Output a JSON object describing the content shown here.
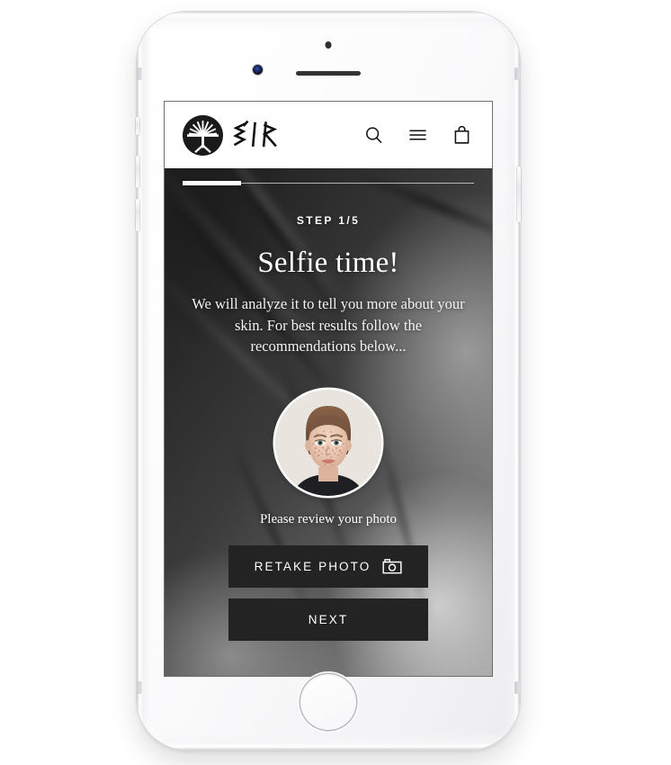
{
  "device": {
    "name": "iphone-white",
    "hardware": {
      "front_camera": "front-camera",
      "earpiece": "earpiece-speaker",
      "sensor": "proximity-sensor",
      "home_button": "home-button",
      "silent_switch": "silent-switch",
      "volume_up": "volume-up-button",
      "volume_down": "volume-down-button",
      "power": "power-button"
    }
  },
  "header": {
    "logo_name": "eir-tree-logo",
    "wordmark": "EIR",
    "icons": [
      {
        "name": "search-icon",
        "label": "Search"
      },
      {
        "name": "hamburger-menu-icon",
        "label": "Menu"
      },
      {
        "name": "shopping-bag-icon",
        "label": "Cart"
      }
    ]
  },
  "progress": {
    "percent": 20,
    "current_step": 1,
    "total_steps": 5,
    "fill_color": "#ffffff",
    "track_color": "#e8e8e8"
  },
  "main": {
    "step_label": "STEP 1/5",
    "headline": "Selfie time!",
    "subcopy": "We will analyze it to tell you more about your skin. For best results follow the recommendations below...",
    "avatar_name": "user-selfie-photo",
    "review_text": "Please review your photo",
    "buttons": [
      {
        "name": "retake-photo-button",
        "label": "RETAKE PHOTO",
        "icon": "camera-icon"
      },
      {
        "name": "next-button",
        "label": "NEXT",
        "icon": null
      }
    ]
  },
  "colors": {
    "button_bg": "#232323",
    "text_on_dark": "#ffffff",
    "header_bg": "#ffffff",
    "logo_bg": "#1a1a1a",
    "page_bg": "#ffffff"
  }
}
